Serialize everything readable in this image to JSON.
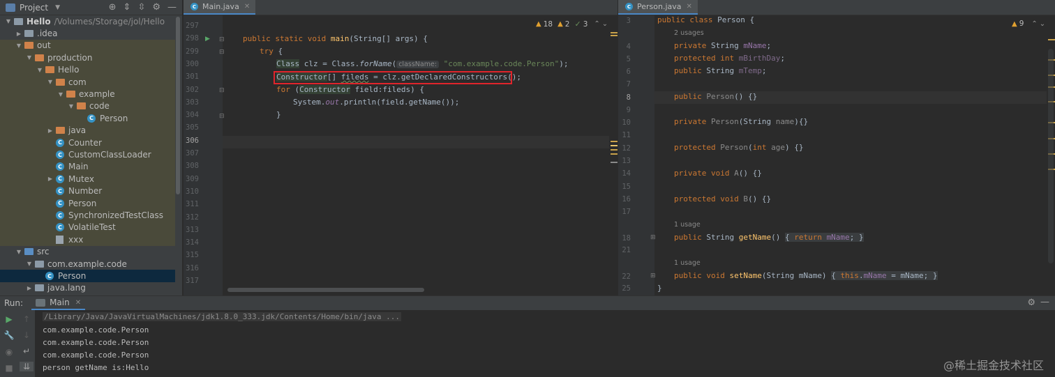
{
  "project": {
    "title": "Project",
    "tree": [
      {
        "label": "Hello",
        "sub": "/Volumes/Storage/jol/Hello",
        "depth": 0,
        "icon": "project",
        "arrow": "down",
        "bold": true
      },
      {
        "label": ".idea",
        "depth": 1,
        "icon": "folder-grey",
        "arrow": "right"
      },
      {
        "label": "out",
        "depth": 1,
        "icon": "folder-orange",
        "arrow": "down",
        "hl": true
      },
      {
        "label": "production",
        "depth": 2,
        "icon": "folder-orange",
        "arrow": "down",
        "hl": true
      },
      {
        "label": "Hello",
        "depth": 3,
        "icon": "folder-orange",
        "arrow": "down",
        "hl": true
      },
      {
        "label": "com",
        "depth": 4,
        "icon": "folder-orange",
        "arrow": "down",
        "hl": true
      },
      {
        "label": "example",
        "depth": 5,
        "icon": "folder-orange",
        "arrow": "down",
        "hl": true
      },
      {
        "label": "code",
        "depth": 6,
        "icon": "folder-orange",
        "arrow": "down",
        "hl": true
      },
      {
        "label": "Person",
        "depth": 7,
        "icon": "class",
        "arrow": "",
        "hl": true
      },
      {
        "label": "java",
        "depth": 4,
        "icon": "folder-orange",
        "arrow": "right",
        "hl": true
      },
      {
        "label": "Counter",
        "depth": 4,
        "icon": "class",
        "arrow": "",
        "hl": true
      },
      {
        "label": "CustomClassLoader",
        "depth": 4,
        "icon": "class",
        "arrow": "",
        "hl": true
      },
      {
        "label": "Main",
        "depth": 4,
        "icon": "class",
        "arrow": "",
        "hl": true
      },
      {
        "label": "Mutex",
        "depth": 4,
        "icon": "class",
        "arrow": "right",
        "hl": true
      },
      {
        "label": "Number",
        "depth": 4,
        "icon": "class",
        "arrow": "",
        "hl": true
      },
      {
        "label": "Person",
        "depth": 4,
        "icon": "class",
        "arrow": "",
        "hl": true
      },
      {
        "label": "SynchronizedTestClass",
        "depth": 4,
        "icon": "class",
        "arrow": "",
        "hl": true
      },
      {
        "label": "VolatileTest",
        "depth": 4,
        "icon": "class",
        "arrow": "",
        "hl": true
      },
      {
        "label": "xxx",
        "depth": 4,
        "icon": "file",
        "arrow": "",
        "hl": true
      },
      {
        "label": "src",
        "depth": 1,
        "icon": "folder-blue",
        "arrow": "down"
      },
      {
        "label": "com.example.code",
        "depth": 2,
        "icon": "folder-grey",
        "arrow": "down"
      },
      {
        "label": "Person",
        "depth": 3,
        "icon": "class",
        "arrow": "",
        "sel": true
      },
      {
        "label": "java.lang",
        "depth": 2,
        "icon": "folder-grey",
        "arrow": "right"
      }
    ]
  },
  "editor_left": {
    "tab": "Main.java",
    "inspections": {
      "warnings": "18",
      "weak": "2",
      "ok": "3"
    },
    "line_numbers": [
      "297",
      "298",
      "299",
      "300",
      "301",
      "302",
      "303",
      "304",
      "305",
      "306",
      "307",
      "308",
      "309",
      "310",
      "311",
      "312",
      "313",
      "314",
      "315",
      "316",
      "317"
    ],
    "current_line": "306",
    "hint_label": "className:",
    "code": {
      "l298_a": "public static void ",
      "l298_fn": "main",
      "l298_b": "(String[] args) {",
      "l299_kw": "try",
      "l299_b": " {",
      "l300_type": "Class",
      "l300_a": " clz = Class.",
      "l300_m": "forName",
      "l300_b": "(",
      "l300_str": "\"com.example.code.Person\"",
      "l300_c": ");",
      "l301_type": "Constructor",
      "l301_a": "[] ",
      "l301_var": "fileds",
      "l301_b": " = clz.getDeclaredConstructors();",
      "l302_kw": "for",
      "l302_a": " (",
      "l302_type": "Constructor",
      "l302_b": " field:fileds) {",
      "l303_a": "System.",
      "l303_out": "out",
      "l303_b": ".println(field.getName());",
      "l304": "}"
    }
  },
  "editor_right": {
    "tab": "Person.java",
    "inspections": {
      "warnings": "9"
    },
    "line_numbers": [
      "3",
      "4",
      "5",
      "6",
      "7",
      "8",
      "9",
      "10",
      "11",
      "12",
      "13",
      "14",
      "15",
      "16",
      "17",
      "18",
      "21",
      "22",
      "25"
    ],
    "current_line": "8",
    "usages": {
      "two": "2 usages",
      "one_a": "1 usage",
      "one_b": "1 usage"
    },
    "code": {
      "l3_kw": "public class ",
      "l3_b": "Person {",
      "l4_kw": "private ",
      "l4_a": "String ",
      "l4_f": "mName",
      "l4_b": ";",
      "l5_kw": "protected int ",
      "l5_f": "mBirthDay",
      "l5_b": ";",
      "l6_kw": "public ",
      "l6_a": "String ",
      "l6_f": "mTemp",
      "l6_b": ";",
      "l8_kw": "public ",
      "l8_n": "Person",
      "l8_b": "() {}",
      "l10_kw": "private ",
      "l10_n": "Person",
      "l10_a": "(String ",
      "l10_p": "name",
      "l10_b": "){}",
      "l12_kw": "protected ",
      "l12_n": "Person",
      "l12_a": "(",
      "l12_kw2": "int ",
      "l12_p": "age",
      "l12_b": ") {}",
      "l14_kw": "private void ",
      "l14_n": "A",
      "l14_b": "() {}",
      "l16_kw": "protected void ",
      "l16_n": "B",
      "l16_b": "() {}",
      "l18_kw": "public ",
      "l18_a": "String ",
      "l18_fn": "getName",
      "l18_b": "() ",
      "l18_c": "{ ",
      "l18_kw2": "return ",
      "l18_f": "mName",
      "l18_d": "; }",
      "l22_kw": "public void ",
      "l22_fn": "setName",
      "l22_a": "(String mName) ",
      "l22_c": "{ ",
      "l22_kw2": "this",
      "l22_b": ".",
      "l22_f": "mName",
      "l22_d": " = mName; }",
      "l25": "}"
    }
  },
  "run": {
    "label": "Run:",
    "tab": "Main",
    "lines": [
      "/Library/Java/JavaVirtualMachines/jdk1.8.0_333.jdk/Contents/Home/bin/java ...",
      "com.example.code.Person",
      "com.example.code.Person",
      "com.example.code.Person",
      "person getName is:Hello"
    ]
  },
  "watermark": "@稀土掘金技术社区",
  "colors": {
    "accent": "#4a88c7",
    "highlight_box": "#e0242b",
    "keyword": "#cc7832",
    "string": "#6a8759",
    "field": "#9876aa",
    "method": "#ffc66d"
  }
}
